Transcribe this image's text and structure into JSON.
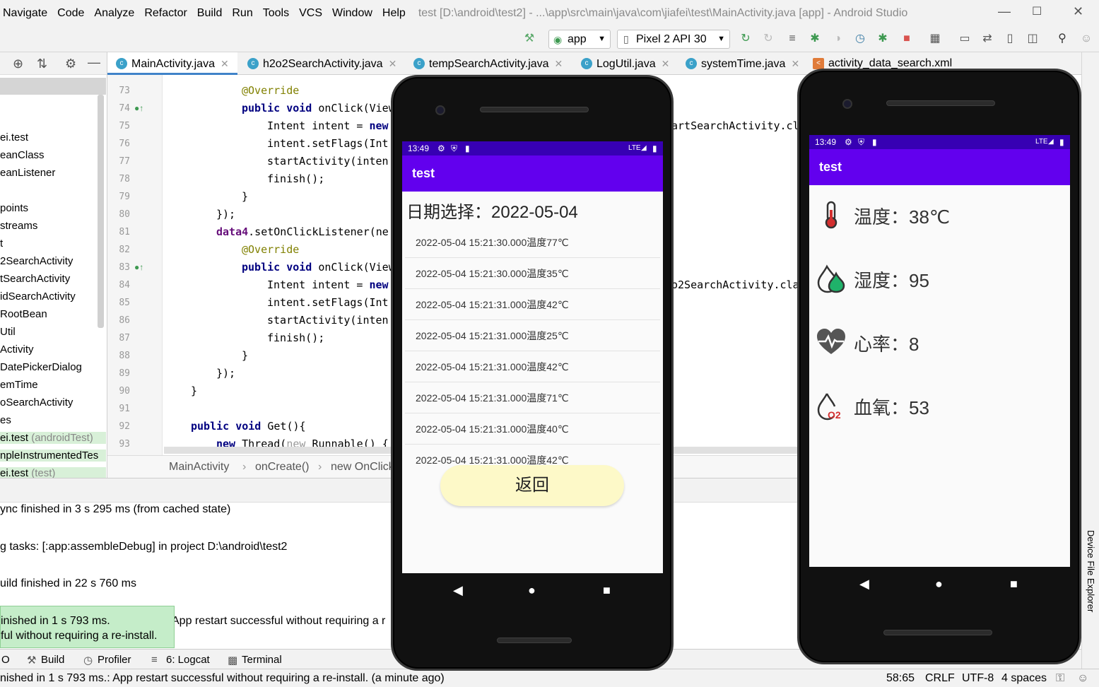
{
  "menu": [
    "Navigate",
    "Code",
    "Analyze",
    "Refactor",
    "Build",
    "Run",
    "Tools",
    "VCS",
    "Window",
    "Help"
  ],
  "window_title": "test [D:\\android\\test2] - ...\\app\\src\\main\\java\\com\\jiafei\\test\\MainActivity.java [app] - Android Studio",
  "toolbar": {
    "run_config": "app",
    "device": "Pixel 2 API 30"
  },
  "tabs": [
    "MainActivity.java",
    "h2o2SearchActivity.java",
    "tempSearchActivity.java",
    "LogUtil.java",
    "systemTime.java",
    "activity_data_search.xml"
  ],
  "tree": [
    "ei.test",
    "eanClass",
    "eanListener",
    "",
    "points",
    "streams",
    "t",
    "2SearchActivity",
    "tSearchActivity",
    "idSearchActivity",
    "RootBean",
    "Util",
    "Activity",
    "DatePickerDialog",
    "emTime",
    "oSearchActivity",
    "es",
    "ei.test",
    "npleInstrumentedTes",
    "ei.test"
  ],
  "tree_suffix_android_test": "(androidTest)",
  "tree_suffix_test": "(test)",
  "code": {
    "line_numbers": [
      "73",
      "74",
      "75",
      "76",
      "77",
      "78",
      "79",
      "80",
      "81",
      "82",
      "83",
      "84",
      "85",
      "86",
      "87",
      "88",
      "89",
      "90",
      "91",
      "92",
      "93"
    ],
    "l73": "@Override",
    "l74a": "public void",
    "l74b": " onClick(View",
    "l75a": "Intent intent = ",
    "l75b": "new",
    "l75r": "artSearchActivity.cl",
    "l76": "intent.setFlags(Int",
    "l77": "startActivity(inten",
    "l78": "finish();",
    "l79": "}",
    "l80": "});",
    "l81a": "data4",
    "l81b": ".setOnClickListener(ne",
    "l82": "@Override",
    "l83a": "public void",
    "l83b": " onClick(View",
    "l84a": "Intent intent = ",
    "l84b": "new",
    "l84r": "o2SearchActivity.cla",
    "l85": "intent.setFlags(Int",
    "l86": "startActivity(inten",
    "l87": "finish();",
    "l88": "}",
    "l89": "});",
    "l90": "}",
    "l92a": "public void",
    "l92b": " Get(){",
    "l93a": "new",
    "l93b": " Thread(",
    "l93c": "new",
    "l93d": " Runnable() {"
  },
  "breadcrumb": [
    "MainActivity",
    "onCreate()",
    "new OnClick"
  ],
  "log": [
    "ync finished in 3 s 295 ms (from cached state)",
    "g tasks: [:app:assembleDebug] in project D:\\android\\test2",
    "uild finished in 22 s 760 ms",
    "App restart successful without requiring a r"
  ],
  "toast": [
    "inished in 1 s 793 ms.",
    "ful without requiring a re-install."
  ],
  "tool_tabs": [
    "O",
    "Build",
    "Profiler",
    "6: Logcat",
    "Terminal"
  ],
  "status": {
    "message": "nished in 1 s 793 ms.: App restart successful without requiring a re-install. (a minute ago)",
    "position": "58:65",
    "line_sep": "CRLF",
    "encoding": "UTF-8",
    "indent": "4 spaces"
  },
  "side_panel_label": "Device File Explorer",
  "phone1": {
    "time": "13:49",
    "network": "LTE",
    "app_title": "test",
    "date_label": "日期选择：2022-05-04",
    "records": [
      "2022-05-04 15:21:30.000温度77℃",
      "2022-05-04 15:21:30.000温度35℃",
      "2022-05-04 15:21:31.000温度42℃",
      "2022-05-04 15:21:31.000温度25℃",
      "2022-05-04 15:21:31.000温度42℃",
      "2022-05-04 15:21:31.000温度71℃",
      "2022-05-04 15:21:31.000温度40℃",
      "2022-05-04 15:21:31.000温度42℃"
    ],
    "back_button": "返回"
  },
  "phone2": {
    "time": "13:49",
    "network": "LTE",
    "app_title": "test",
    "temperature": "温度：38℃",
    "humidity": "湿度：95",
    "heart_rate": "心率：8",
    "blood_oxygen": "血氧：53",
    "o2_icon_text": "O2"
  },
  "colors": {
    "status_bar": "#3700b3",
    "app_bar": "#6200ee",
    "back_button": "#fdf9c8",
    "toast": "#c5edc9"
  }
}
